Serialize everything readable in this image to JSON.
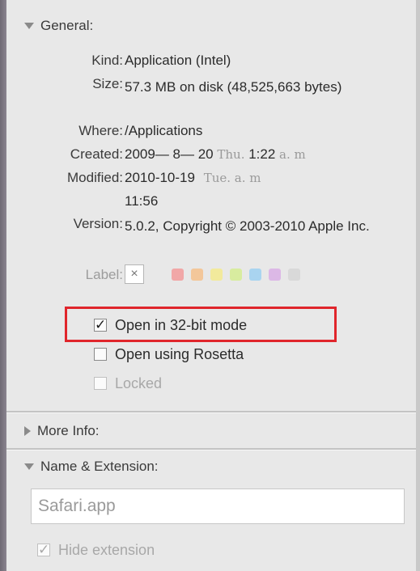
{
  "general": {
    "header": "General:",
    "rows": [
      {
        "key": "Kind:",
        "value": "Application (Intel)"
      },
      {
        "key": "Size:",
        "value": "57.3 MB on disk (48,525,663 bytes)"
      },
      {
        "key": "Where:",
        "value": "/Applications"
      },
      {
        "key": "Created:",
        "value_main": "2009— 8— 20",
        "value_faint": "Thu.",
        "value_main2": "1:22",
        "value_faint2": "a. m"
      },
      {
        "key": "Modified:",
        "value_main": "2010-10-19",
        "value_faint": "Tue. a. m",
        "value_line2": "11:56"
      },
      {
        "key": "Version:",
        "value": "5.0.2, Copyright © 2003-2010 Apple Inc."
      }
    ],
    "label_key": "Label:",
    "label_clear": "×",
    "label_colors": [
      "#f1a7a7",
      "#f3c79a",
      "#f2ea9c",
      "#d8ec9f",
      "#a9d4f0",
      "#dcb8e6",
      "#d9d9d9"
    ],
    "checkboxes": [
      {
        "label": "Open in 32-bit mode",
        "checked": true,
        "enabled": true
      },
      {
        "label": "Open using Rosetta",
        "checked": false,
        "enabled": true
      },
      {
        "label": "Locked",
        "checked": false,
        "enabled": false
      }
    ]
  },
  "more_info": {
    "header": "More Info:"
  },
  "name_extension": {
    "header": "Name & Extension:",
    "filename": "Safari.app",
    "hide_extension_label": "Hide extension",
    "hide_extension_checked": true
  },
  "colors": {
    "highlight": "#e0252b"
  }
}
